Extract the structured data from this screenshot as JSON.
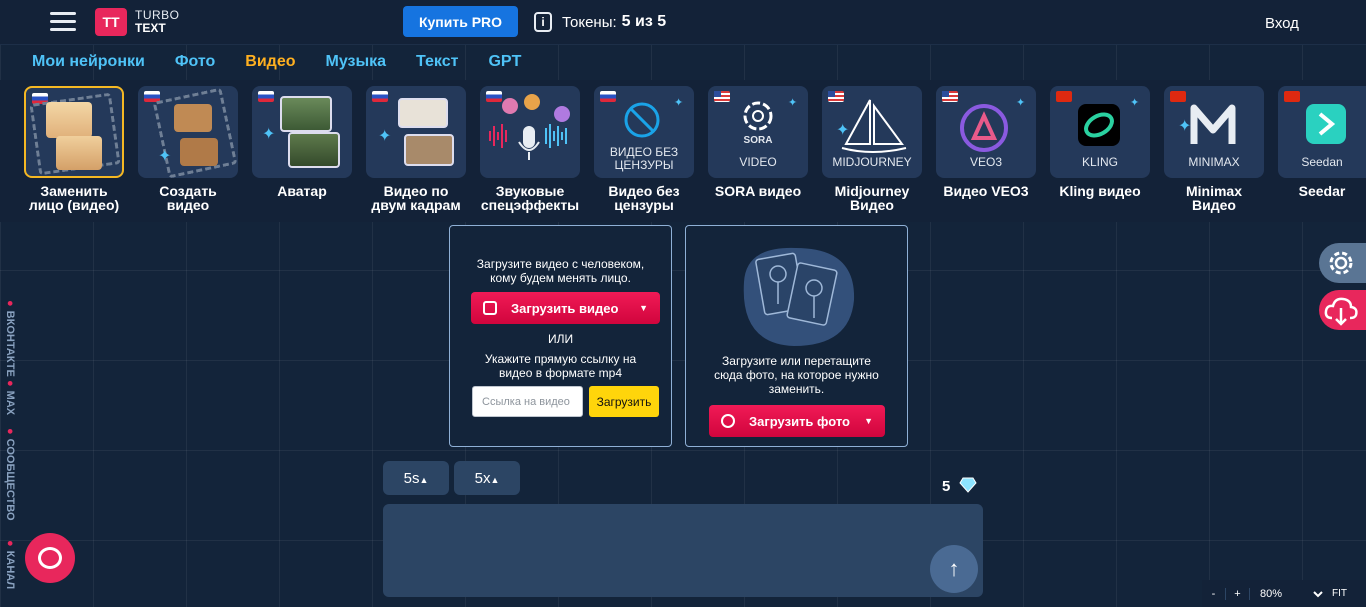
{
  "header": {
    "logo_mark": "TT",
    "logo_line1": "TURBO",
    "logo_line2": "TEXT",
    "pro_button": "Купить PRO",
    "tokens_label": "Токены:",
    "tokens_value": "5 из 5",
    "login": "Вход"
  },
  "tabs": [
    {
      "label": "Мои нейронки",
      "active": false
    },
    {
      "label": "Фото",
      "active": false
    },
    {
      "label": "Видео",
      "active": true
    },
    {
      "label": "Музыка",
      "active": false
    },
    {
      "label": "Текст",
      "active": false
    },
    {
      "label": "GPT",
      "active": false
    }
  ],
  "tiles": [
    {
      "label": "Заменить лицо (видео)",
      "flag": "ru",
      "selected": true
    },
    {
      "label": "Создать видео",
      "flag": "ru"
    },
    {
      "label": "Аватар",
      "flag": "ru"
    },
    {
      "label": "Видео по двум кадрам",
      "flag": "ru"
    },
    {
      "label": "Звуковые спецэффекты",
      "flag": "ru"
    },
    {
      "label": "Видео без цензуры",
      "flag": "ru",
      "caption": "ВИДЕО БЕЗ ЦЕНЗУРЫ"
    },
    {
      "label": "SORA видео",
      "flag": "us",
      "caption": "VIDEO",
      "logo_text": "SORA"
    },
    {
      "label": "Midjourney Видео",
      "flag": "us",
      "caption": "MIDJOURNEY"
    },
    {
      "label": "Видео VEO3",
      "flag": "us",
      "caption": "VEO3"
    },
    {
      "label": "Kling видео",
      "flag": "cn",
      "caption": "KLING"
    },
    {
      "label": "Minimax Видео",
      "flag": "cn",
      "caption": "MINIMAX"
    },
    {
      "label": "Seedar",
      "flag": "cn",
      "caption": "Seedan"
    }
  ],
  "video_panel": {
    "instruction": "Загрузите видео с человеком, кому будем менять лицо.",
    "upload_button": "Загрузить видео",
    "or": "ИЛИ",
    "url_hint": "Укажите прямую ссылку на видео в формате mp4",
    "url_placeholder": "Ссылка на видео",
    "url_button": "Загрузить"
  },
  "photo_panel": {
    "instruction": "Загрузите или перетащите сюда фото, на которое нужно заменить.",
    "upload_button": "Загрузить фото"
  },
  "controls": {
    "duration": "5s",
    "speed": "5x",
    "gem_count": "5"
  },
  "side_links": [
    {
      "label": "ВКОНТАКТЕ"
    },
    {
      "label": "MAX"
    },
    {
      "label": "СООБЩЕСТВО"
    },
    {
      "label": "КАНАЛ"
    }
  ],
  "zoom": {
    "minus": "-",
    "plus": "+",
    "value": "80%",
    "fit": "FIT"
  },
  "colors": {
    "accent_red": "#e8275c",
    "accent_blue": "#1674e0",
    "tab_link": "#4fc3f7",
    "tab_active": "#ffb020"
  }
}
